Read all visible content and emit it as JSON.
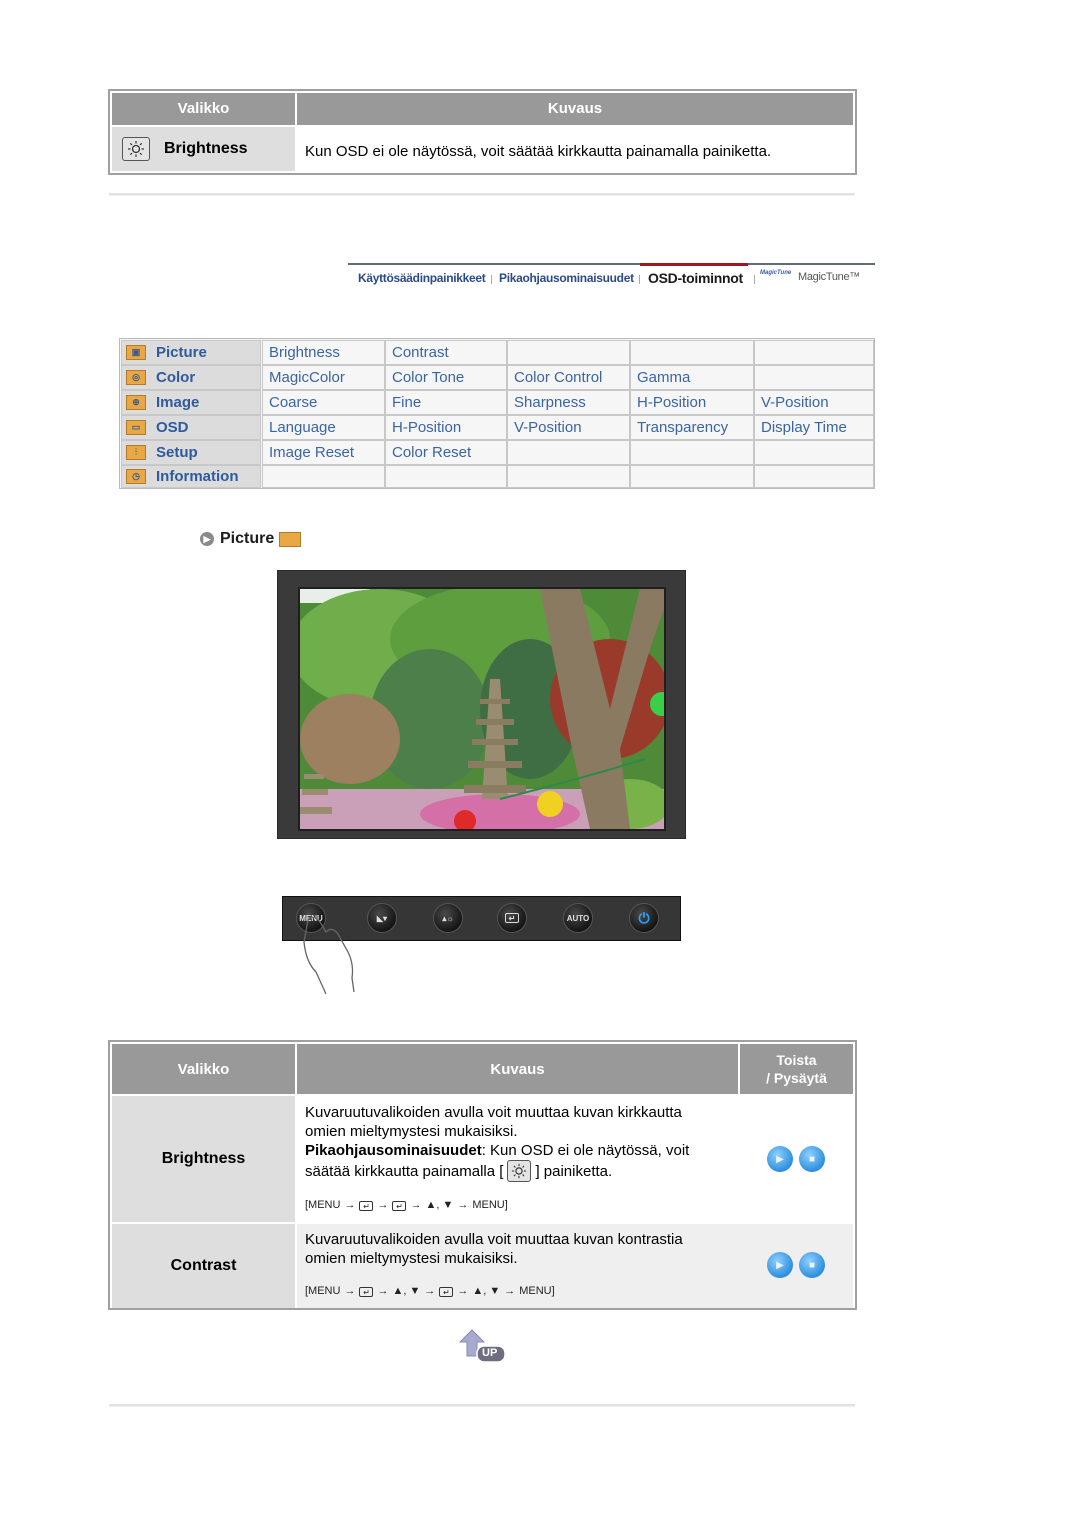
{
  "top_table": {
    "headers": [
      "Valikko",
      "Kuvaus"
    ],
    "row": {
      "menu": "Brightness",
      "icon": "brightness-sun-icon",
      "description": "Kun OSD ei ole näytössä, voit säätää kirkkautta painamalla painiketta."
    }
  },
  "nav": {
    "tabs": [
      {
        "label": "Käyttösäädinpainikkeet",
        "active": false
      },
      {
        "label": "Pikaohjausominaisuudet",
        "active": false
      },
      {
        "label": "OSD-toiminnot",
        "active": true
      },
      {
        "label": "MagicTune™",
        "active": false,
        "logo": "magictune-logo-icon"
      }
    ],
    "accent_color": "#9c1a1a"
  },
  "osd_grid": {
    "rows": [
      {
        "menu": "Picture",
        "icon": "picture-icon",
        "items": [
          "Brightness",
          "Contrast",
          "",
          "",
          ""
        ]
      },
      {
        "menu": "Color",
        "icon": "color-icon",
        "items": [
          "MagicColor",
          "Color Tone",
          "Color Control",
          "Gamma",
          ""
        ]
      },
      {
        "menu": "Image",
        "icon": "image-icon",
        "items": [
          "Coarse",
          "Fine",
          "Sharpness",
          "H-Position",
          "V-Position"
        ]
      },
      {
        "menu": "OSD",
        "icon": "osd-icon",
        "items": [
          "Language",
          "H-Position",
          "V-Position",
          "Transparency",
          "Display Time"
        ]
      },
      {
        "menu": "Setup",
        "icon": "setup-icon",
        "items": [
          "Image Reset",
          "Color Reset",
          "",
          "",
          ""
        ]
      },
      {
        "menu": "Information",
        "icon": "information-icon",
        "items": [
          "",
          "",
          "",
          "",
          ""
        ]
      }
    ],
    "link_color": "#3a64a4",
    "menu_color": "#2f5a9e"
  },
  "section": {
    "title": "Picture",
    "icon": "picture-icon"
  },
  "monitor": {
    "screen_image": "garden-pagoda-photo"
  },
  "button_bar": {
    "buttons": [
      {
        "label": "MENU",
        "icon": "menu-icon"
      },
      {
        "label": "",
        "icon": "magicbright-down-icon"
      },
      {
        "label": "",
        "icon": "up-brightness-icon"
      },
      {
        "label": "",
        "icon": "enter-icon"
      },
      {
        "label": "AUTO",
        "icon": "auto-icon"
      },
      {
        "label": "",
        "icon": "power-icon"
      }
    ],
    "pointer": "hand-pointer-icon"
  },
  "bottom_table": {
    "headers": {
      "menu": "Valikko",
      "desc": "Kuvaus",
      "play_line1": "Toista",
      "play_line2": "/ Pysäytä"
    },
    "rows": [
      {
        "menu": "Brightness",
        "desc_line1": "Kuvaruutuvalikoiden avulla voit muuttaa kuvan kirkkautta",
        "desc_line2": "omien mieltymystesi mukaisiksi.",
        "bold_label": "Pikaohjausominaisuudet",
        "desc_line3_rest": ": Kun OSD ei ole näytössä, voit",
        "desc_line4_pre": "säätää kirkkautta painamalla [",
        "desc_line4_post": "] painiketta.",
        "sequence": [
          "[MENU",
          "→",
          "enter",
          "→",
          "enter",
          "→",
          "▲, ▼",
          "→",
          "MENU]"
        ]
      },
      {
        "menu": "Contrast",
        "desc_line1": "Kuvaruutuvalikoiden avulla voit muuttaa kuvan kontrastia",
        "desc_line2": "omien mieltymystesi mukaisiksi.",
        "sequence": [
          "[MENU",
          "→",
          "enter",
          "→",
          "▲, ▼",
          "→",
          "enter",
          "→",
          "▲, ▼",
          "→",
          "MENU]"
        ]
      }
    ],
    "play_label": "play",
    "stop_label": "stop"
  },
  "footer": {
    "up_label": "UP"
  }
}
